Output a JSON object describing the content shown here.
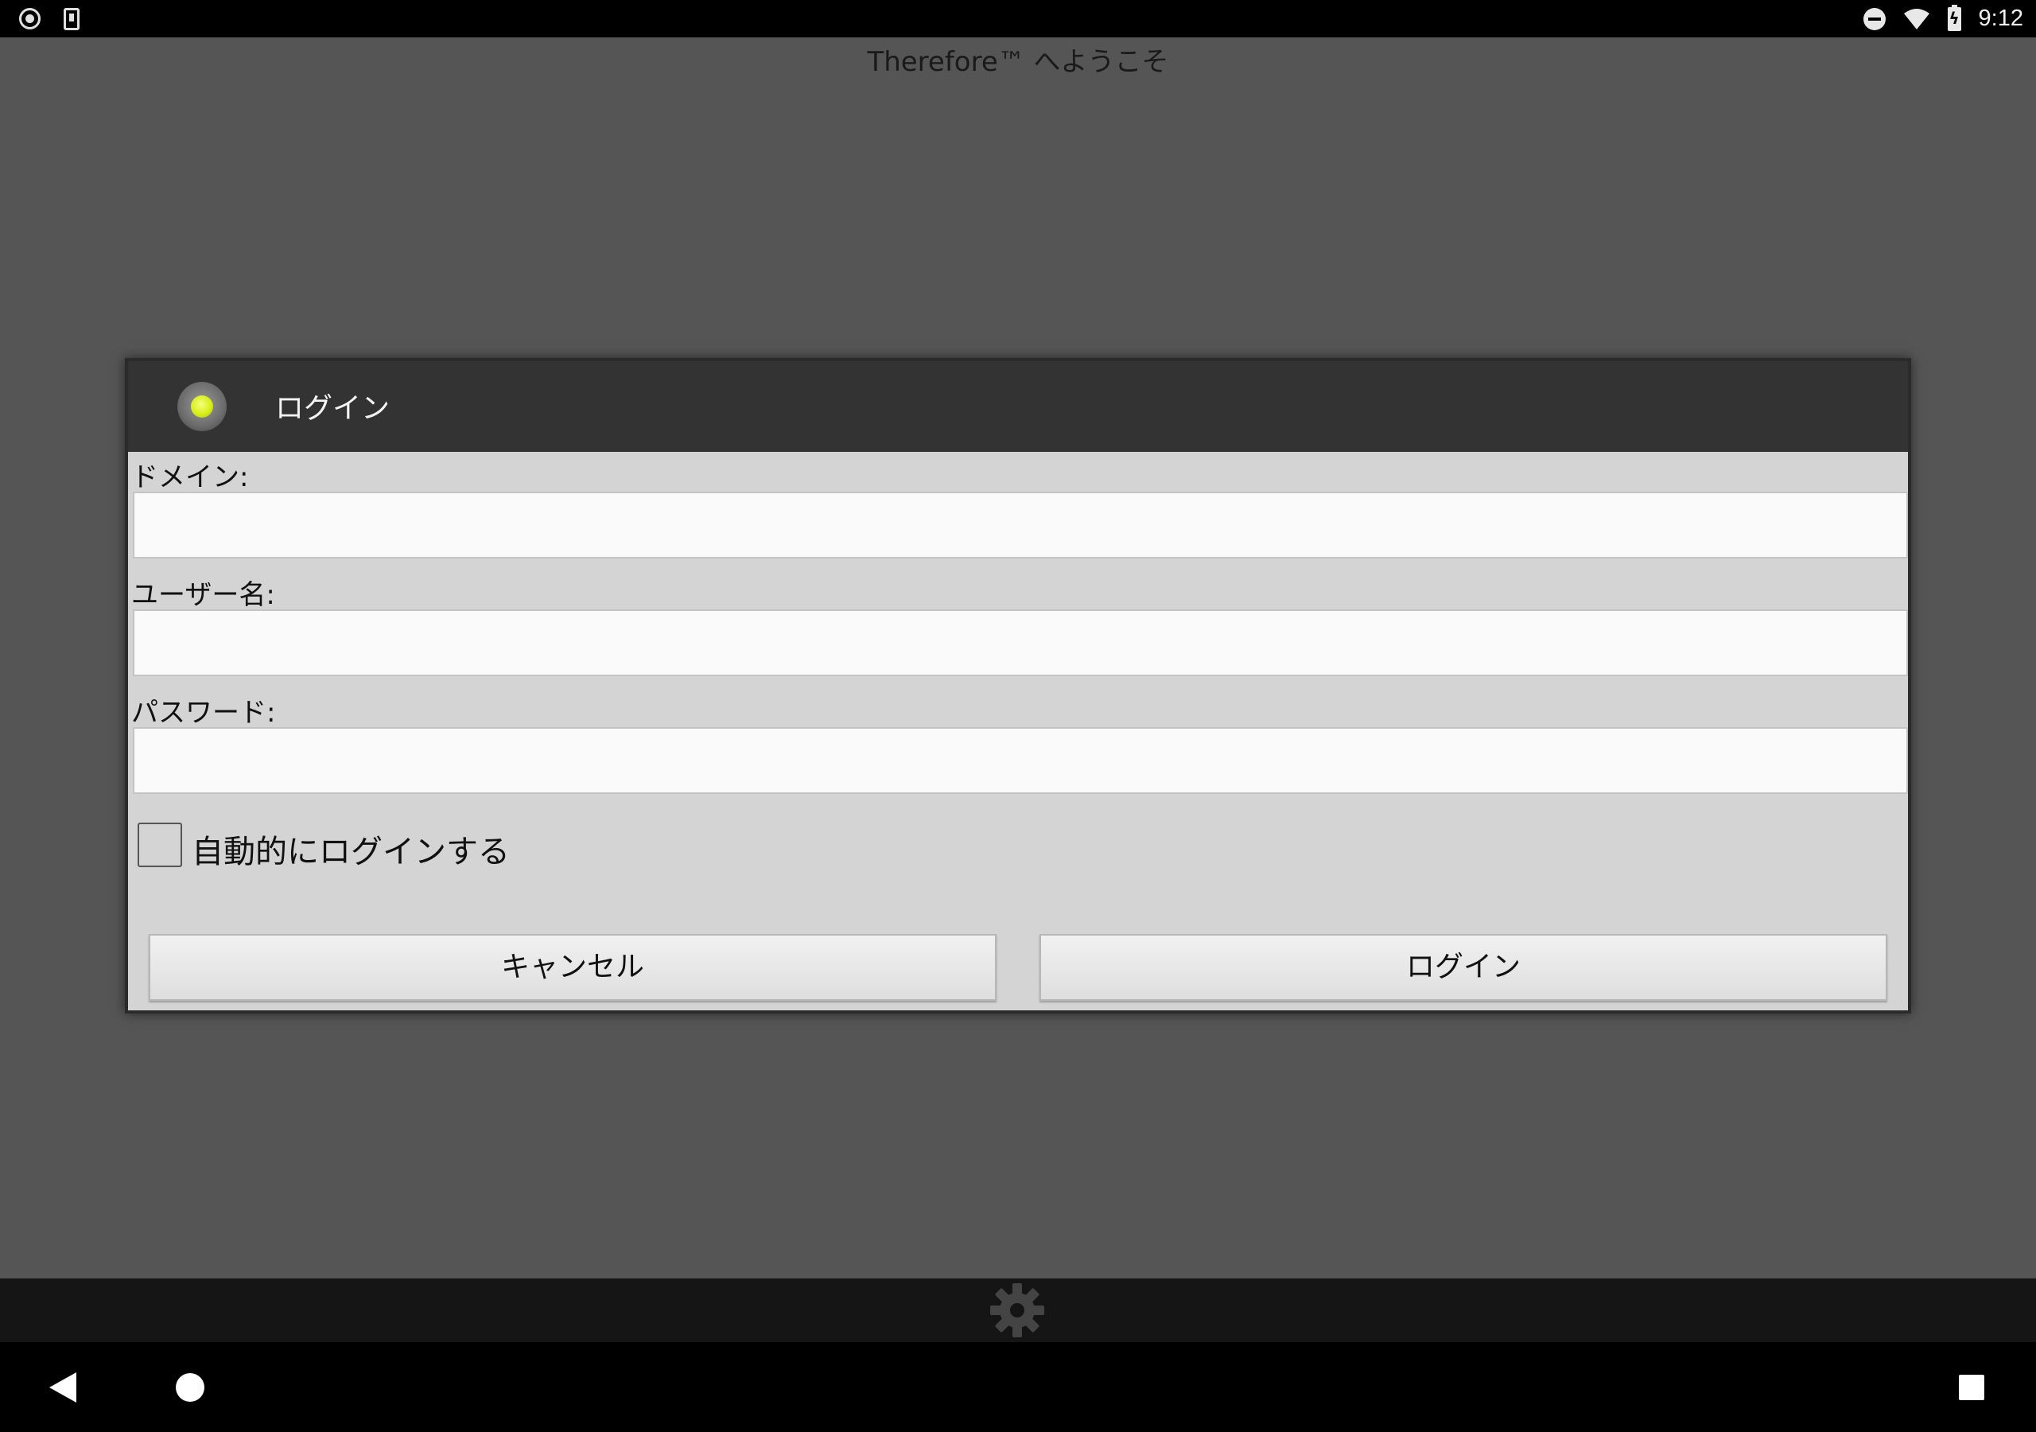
{
  "status_bar": {
    "time": "9:12",
    "icons": [
      "record-icon",
      "download-icon",
      "dnd-icon",
      "wifi-icon",
      "battery-charging-icon"
    ]
  },
  "app": {
    "title": "Therefore™ へようこそ"
  },
  "dialog": {
    "title": "ログイン",
    "status_led_color": "#d8ee1a",
    "fields": {
      "domain": {
        "label": "ドメイン:",
        "value": ""
      },
      "username": {
        "label": "ユーザー名:",
        "value": ""
      },
      "password": {
        "label": "パスワード:",
        "value": ""
      }
    },
    "auto_login": {
      "label": "自動的にログインする",
      "checked": false
    },
    "buttons": {
      "cancel": "キャンセル",
      "login": "ログイン"
    }
  },
  "toolbar": {
    "icon": "gear-icon"
  },
  "navigation": {
    "icons": [
      "back-icon",
      "home-icon",
      "recents-icon"
    ]
  }
}
